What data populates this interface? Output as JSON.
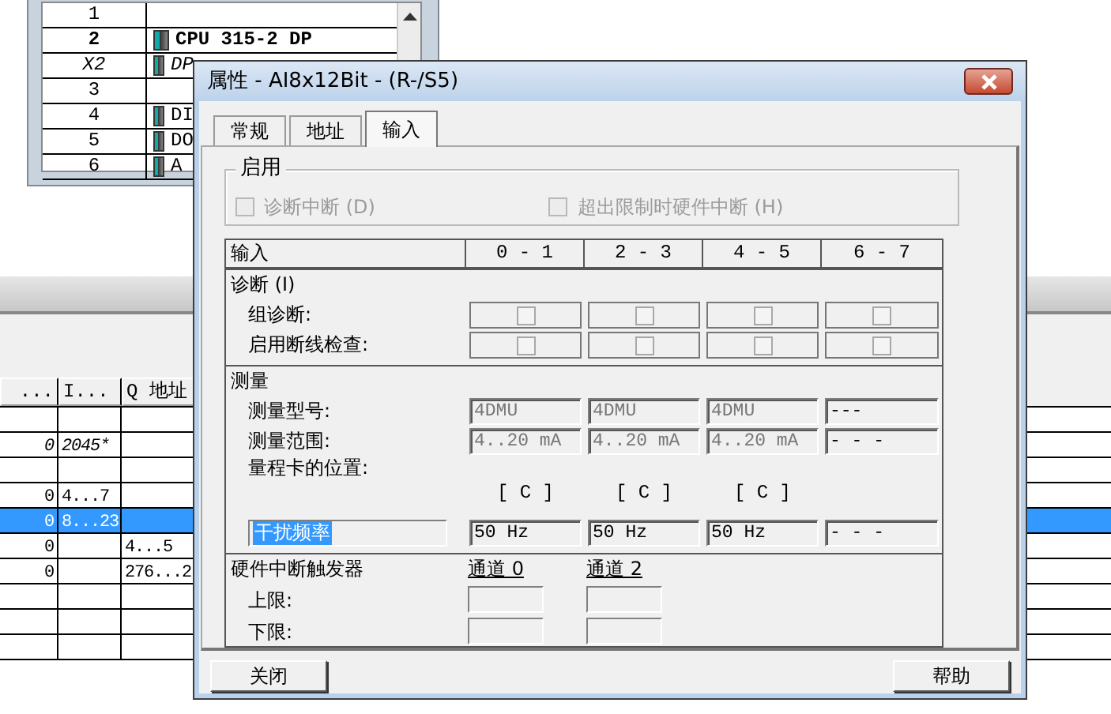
{
  "rack_window": {
    "rows": [
      {
        "slot": "1",
        "kind": "empty"
      },
      {
        "slot": "2",
        "module": "CPU 315-2 DP",
        "kind": "cpu"
      },
      {
        "slot": "X2",
        "module": "DP",
        "kind": "interface"
      },
      {
        "slot": "3",
        "kind": "empty"
      },
      {
        "slot": "4",
        "module": "DI",
        "kind": "module"
      },
      {
        "slot": "5",
        "module": "DO",
        "kind": "module"
      },
      {
        "slot": "6",
        "module": "A",
        "kind": "module"
      }
    ]
  },
  "module_table": {
    "columns": [
      "...",
      "I...",
      "Q 地址"
    ],
    "rows": [
      {
        "selected": false,
        "kind": "module"
      },
      {
        "col_1": "0",
        "i": "2045*",
        "selected": false,
        "kind": "interface"
      },
      {
        "selected": false,
        "kind": "module"
      },
      {
        "col_1": "0",
        "i": "4...7",
        "selected": false,
        "kind": "module"
      },
      {
        "col_1": "0",
        "i": "8...23",
        "selected": true,
        "kind": "module"
      },
      {
        "col_1": "0",
        "q": "4...5",
        "selected": false,
        "kind": "module"
      },
      {
        "col_1": "0",
        "q": "276...2",
        "selected": false,
        "kind": "module"
      },
      {
        "selected": false,
        "kind": "module"
      },
      {
        "selected": false,
        "kind": "module"
      },
      {
        "selected": false,
        "kind": "module"
      }
    ]
  },
  "dialog": {
    "title": "属性 - AI8x12Bit - (R-/S5)",
    "tabs": [
      {
        "label": "常规",
        "selected": false
      },
      {
        "label": "地址",
        "selected": false
      },
      {
        "label": "输入",
        "selected": true
      }
    ],
    "enable_group": {
      "title": "启用",
      "options": [
        {
          "label": "诊断中断 (D)",
          "checked": false,
          "disabled": true
        },
        {
          "label": "超出限制时硬件中断 (H)",
          "checked": false,
          "disabled": true
        }
      ]
    },
    "grid": {
      "header": "输入",
      "channels": [
        "0 - 1",
        "2 - 3",
        "4 - 5",
        "6 - 7"
      ],
      "diagnostics": {
        "title": "诊断 (I)",
        "rows": [
          {
            "label": "组诊断:",
            "checks": [
              {
                "checked": false
              },
              {
                "checked": false
              },
              {
                "checked": false
              },
              {
                "checked": false
              }
            ]
          },
          {
            "label": "启用断线检查:",
            "checks": [
              {
                "checked": false
              },
              {
                "checked": false
              },
              {
                "checked": false
              },
              {
                "checked": false
              }
            ]
          }
        ]
      },
      "measurement": {
        "title": "测量",
        "type": {
          "label": "测量型号:",
          "values": [
            "4DMU",
            "4DMU",
            "4DMU",
            "---"
          ]
        },
        "range": {
          "label": "测量范围:",
          "values": [
            "4..20 mA",
            "4..20 mA",
            "4..20 mA",
            "- - -"
          ]
        },
        "card_position": {
          "label": "量程卡的位置:",
          "values": [
            "[ C ]",
            "[ C ]",
            "[ C ]"
          ]
        },
        "interference": {
          "label": "干扰频率",
          "selected": true,
          "values": [
            "50 Hz",
            "50 Hz",
            "50 Hz",
            "- - -"
          ]
        }
      },
      "hardware_interrupt": {
        "title": "硬件中断触发器",
        "channels": [
          "通道 0",
          "通道 2"
        ],
        "rows": [
          {
            "label": "上限:"
          },
          {
            "label": "下限:"
          }
        ]
      }
    },
    "buttons": [
      {
        "label": "关闭"
      },
      {
        "label": "帮助"
      }
    ]
  }
}
